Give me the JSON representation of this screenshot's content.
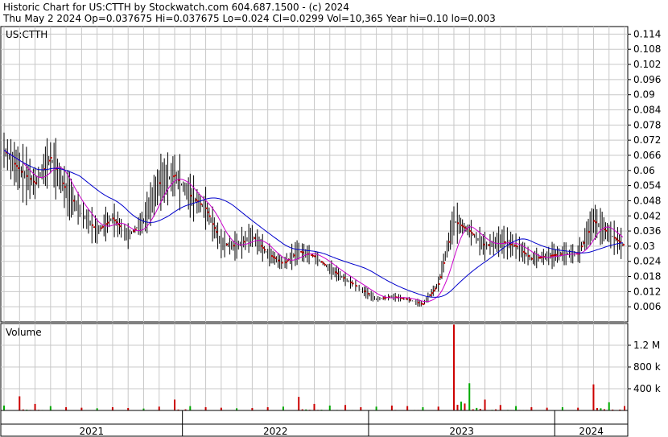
{
  "header": {
    "line1": "Historic Chart for US:CTTH by Stockwatch.com 604.687.1500 - (c) 2024",
    "line2": "Thu May  2 2024  Op=0.037675  Hi=0.037675  Lo=0.024  Cl=0.0299  Vol=10,365  Year hi=0.10  lo=0.003"
  },
  "chart_data": [
    {
      "type": "line",
      "title": "US:CTTH",
      "y_ticks": [
        "0.114",
        "0.108",
        "0.102",
        "0.096",
        "0.09",
        "0.084",
        "0.078",
        "0.072",
        "0.066",
        "0.06",
        "0.054",
        "0.048",
        "0.042",
        "0.036",
        "0.03",
        "0.024",
        "0.018",
        "0.012",
        "0.006"
      ],
      "ylim": [
        0.0,
        0.117
      ],
      "x_labels": [
        "2021",
        "2022",
        "2023",
        "2024"
      ],
      "grid": true,
      "colors": {
        "price": "#000000",
        "close_mark": "#cc0000",
        "ma_short": "#cc00cc",
        "ma_long": "#0000cc"
      },
      "series": [
        {
          "x": [
            "2021-01",
            "2021-02",
            "2021-03",
            "2021-04",
            "2021-05",
            "2021-06",
            "2021-07",
            "2021-08",
            "2021-09",
            "2021-10",
            "2021-11",
            "2021-12",
            "2022-01",
            "2022-02",
            "2022-03",
            "2022-04",
            "2022-05",
            "2022-06",
            "2022-07",
            "2022-08",
            "2022-09",
            "2022-10",
            "2022-11",
            "2022-12",
            "2023-01",
            "2023-02",
            "2023-03",
            "2023-04",
            "2023-05",
            "2023-06",
            "2023-07",
            "2023-08",
            "2023-09",
            "2023-10",
            "2023-11",
            "2023-12",
            "2024-01",
            "2024-02",
            "2024-03",
            "2024-04",
            "2024-05"
          ],
          "values": [
            0.068,
            0.06,
            0.055,
            0.065,
            0.052,
            0.043,
            0.036,
            0.041,
            0.034,
            0.04,
            0.055,
            0.058,
            0.05,
            0.045,
            0.031,
            0.03,
            0.034,
            0.027,
            0.023,
            0.028,
            0.026,
            0.021,
            0.017,
            0.013,
            0.009,
            0.01,
            0.009,
            0.007,
            0.015,
            0.04,
            0.036,
            0.03,
            0.032,
            0.03,
            0.025,
            0.026,
            0.027,
            0.027,
            0.04,
            0.035,
            0.03
          ]
        }
      ]
    },
    {
      "type": "bar",
      "title": "Volume",
      "y_ticks": [
        "1.2 M",
        "800 k",
        "400 k"
      ],
      "ylim": [
        0,
        1600000
      ],
      "colors": {
        "up": "#00aa00",
        "down": "#cc0000"
      },
      "series": [
        {
          "x": [
            "2021-01",
            "2021-02",
            "2021-03",
            "2021-04",
            "2021-05",
            "2021-06",
            "2021-07",
            "2021-08",
            "2021-09",
            "2021-10",
            "2021-11",
            "2021-12",
            "2022-01",
            "2022-02",
            "2022-03",
            "2022-04",
            "2022-05",
            "2022-06",
            "2022-07",
            "2022-08",
            "2022-09",
            "2022-10",
            "2022-11",
            "2022-12",
            "2023-01",
            "2023-02",
            "2023-03",
            "2023-04",
            "2023-05",
            "2023-06",
            "2023-07",
            "2023-08",
            "2023-09",
            "2023-10",
            "2023-11",
            "2023-12",
            "2024-01",
            "2024-02",
            "2024-03",
            "2024-04",
            "2024-05"
          ],
          "values": [
            90000,
            260000,
            120000,
            80000,
            60000,
            50000,
            40000,
            60000,
            45000,
            35000,
            70000,
            200000,
            80000,
            60000,
            50000,
            40000,
            45000,
            60000,
            70000,
            250000,
            120000,
            90000,
            100000,
            60000,
            70000,
            90000,
            80000,
            60000,
            70000,
            1580000,
            500000,
            200000,
            100000,
            80000,
            60000,
            50000,
            60000,
            50000,
            480000,
            150000,
            80000
          ]
        }
      ]
    }
  ]
}
